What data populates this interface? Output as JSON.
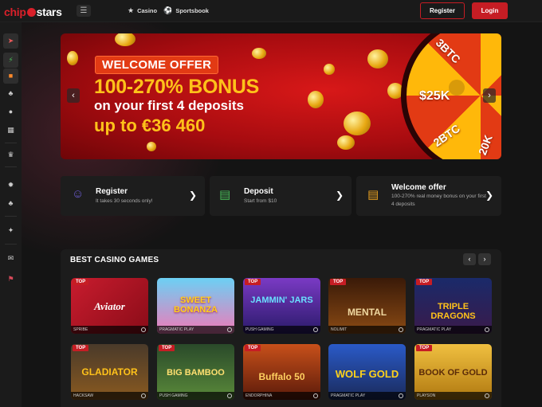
{
  "header": {
    "logo": {
      "part1": "chip",
      "part2": "stars"
    },
    "nav": [
      {
        "label": "Casino",
        "icon": "star-icon"
      },
      {
        "label": "Sportsbook",
        "icon": "soccer-ball-icon"
      }
    ],
    "register_label": "Register",
    "login_label": "Login",
    "colors": {
      "accent": "#c61d24",
      "background": "#141414"
    }
  },
  "sidebar": {
    "items": [
      {
        "icon": "rocket-icon"
      },
      {
        "icon": "lightning-icon"
      },
      {
        "icon": "gift-icon"
      },
      {
        "icon": "cherry-icon"
      },
      {
        "icon": "chips-icon"
      },
      {
        "icon": "grid-icon"
      },
      {
        "icon": "trophy-icon"
      },
      {
        "icon": "roulette-icon"
      },
      {
        "icon": "club-icon"
      },
      {
        "icon": "sparkle-icon"
      },
      {
        "icon": "chat-icon"
      },
      {
        "icon": "flag-uk-icon"
      }
    ]
  },
  "banner": {
    "tag": "WELCOME OFFER",
    "line1": "100-270% BONUS",
    "line2": "on your first 4 deposits",
    "line3": "up to €36 460",
    "wheel_labels": [
      "3BTC",
      "$25K",
      "2BTC",
      "20K"
    ]
  },
  "cards": [
    {
      "title": "Register",
      "subtitle": "It takes 30 seconds only!",
      "icon": "user-icon"
    },
    {
      "title": "Deposit",
      "subtitle": "Start from $10",
      "icon": "wallet-icon"
    },
    {
      "title": "Welcome offer",
      "subtitle": "100-270% real money bonus on your first 4 deposits",
      "icon": "gift-icon"
    }
  ],
  "games": {
    "title": "BEST CASINO GAMES",
    "badge": "TOP",
    "tiles": [
      {
        "title": "Aviator",
        "provider": "SPRIBE",
        "color": "#b21428"
      },
      {
        "title": "SWEET BONANZA",
        "provider": "PRAGMATIC PLAY",
        "color": "#3ab0e6"
      },
      {
        "title": "JAMMIN' JARS",
        "provider": "PUSH GAMING",
        "color": "#5a2a9a"
      },
      {
        "title": "MENTAL",
        "provider": "NOLIMIT",
        "color": "#6a3a10"
      },
      {
        "title": "TRIPLE DRAGONS",
        "provider": "PRAGMATIC PLAY",
        "color": "#1a3a8a"
      },
      {
        "title": "GLADIATOR",
        "provider": "HACKSAW",
        "color": "#5a4020"
      },
      {
        "title": "BIG BAMBOO",
        "provider": "PUSH GAMING",
        "color": "#3a6a2a"
      },
      {
        "title": "Buffalo 50",
        "provider": "ENDORPHINA",
        "color": "#9a3a1a"
      },
      {
        "title": "WOLF GOLD",
        "provider": "PRAGMATIC PLAY",
        "color": "#2a4aa0"
      },
      {
        "title": "BOOK OF GOLD",
        "provider": "PLAYSON",
        "color": "#d49a20"
      }
    ]
  }
}
